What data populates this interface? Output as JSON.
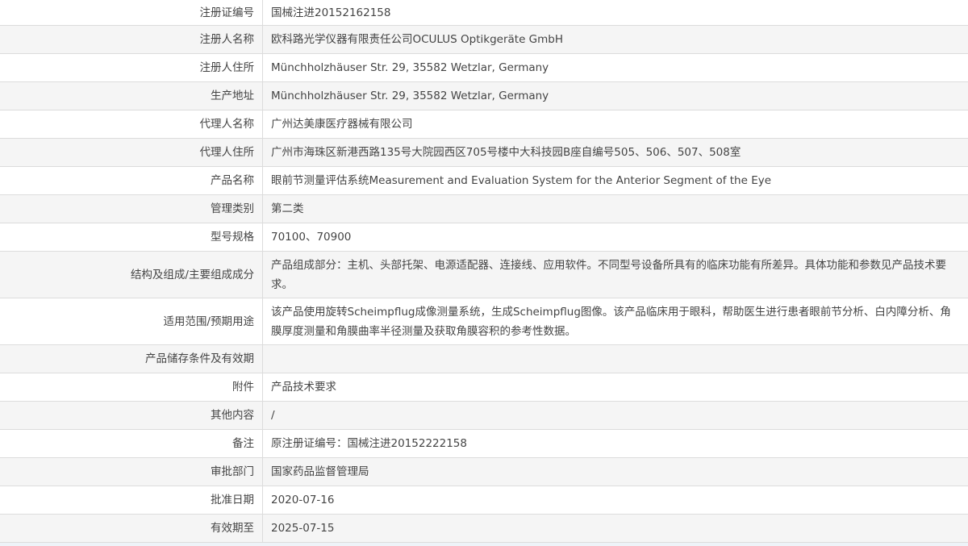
{
  "rows": [
    {
      "label": "注册证编号",
      "value": "国械注进20152162158"
    },
    {
      "label": "注册人名称",
      "value": "欧科路光学仪器有限责任公司OCULUS Optikgeräte GmbH"
    },
    {
      "label": "注册人住所",
      "value": "Münchholzhäuser Str. 29, 35582 Wetzlar, Germany"
    },
    {
      "label": "生产地址",
      "value": "Münchholzhäuser Str. 29, 35582 Wetzlar, Germany"
    },
    {
      "label": "代理人名称",
      "value": "广州达美康医疗器械有限公司"
    },
    {
      "label": "代理人住所",
      "value": "广州市海珠区新港西路135号大院园西区705号楼中大科技园B座自编号505、506、507、508室"
    },
    {
      "label": "产品名称",
      "value": "眼前节测量评估系统Measurement and Evaluation System for the Anterior Segment of the Eye"
    },
    {
      "label": "管理类别",
      "value": "第二类"
    },
    {
      "label": "型号规格",
      "value": "70100、70900"
    },
    {
      "label": "结构及组成/主要组成成分",
      "value": "产品组成部分：主机、头部托架、电源适配器、连接线、应用软件。不同型号设备所具有的临床功能有所差异。具体功能和参数见产品技术要求。"
    },
    {
      "label": "适用范围/预期用途",
      "value": "该产品使用旋转Scheimpflug成像测量系统，生成Scheimpflug图像。该产品临床用于眼科，帮助医生进行患者眼前节分析、白内障分析、角膜厚度测量和角膜曲率半径测量及获取角膜容积的参考性数据。"
    },
    {
      "label": "产品储存条件及有效期",
      "value": ""
    },
    {
      "label": "附件",
      "value": "产品技术要求"
    },
    {
      "label": "其他内容",
      "value": "/"
    },
    {
      "label": "备注",
      "value": "原注册证编号：国械注进20152222158"
    },
    {
      "label": "审批部门",
      "value": "国家药品监督管理局"
    },
    {
      "label": "批准日期",
      "value": "2020-07-16"
    },
    {
      "label": "有效期至",
      "value": "2025-07-15"
    }
  ]
}
